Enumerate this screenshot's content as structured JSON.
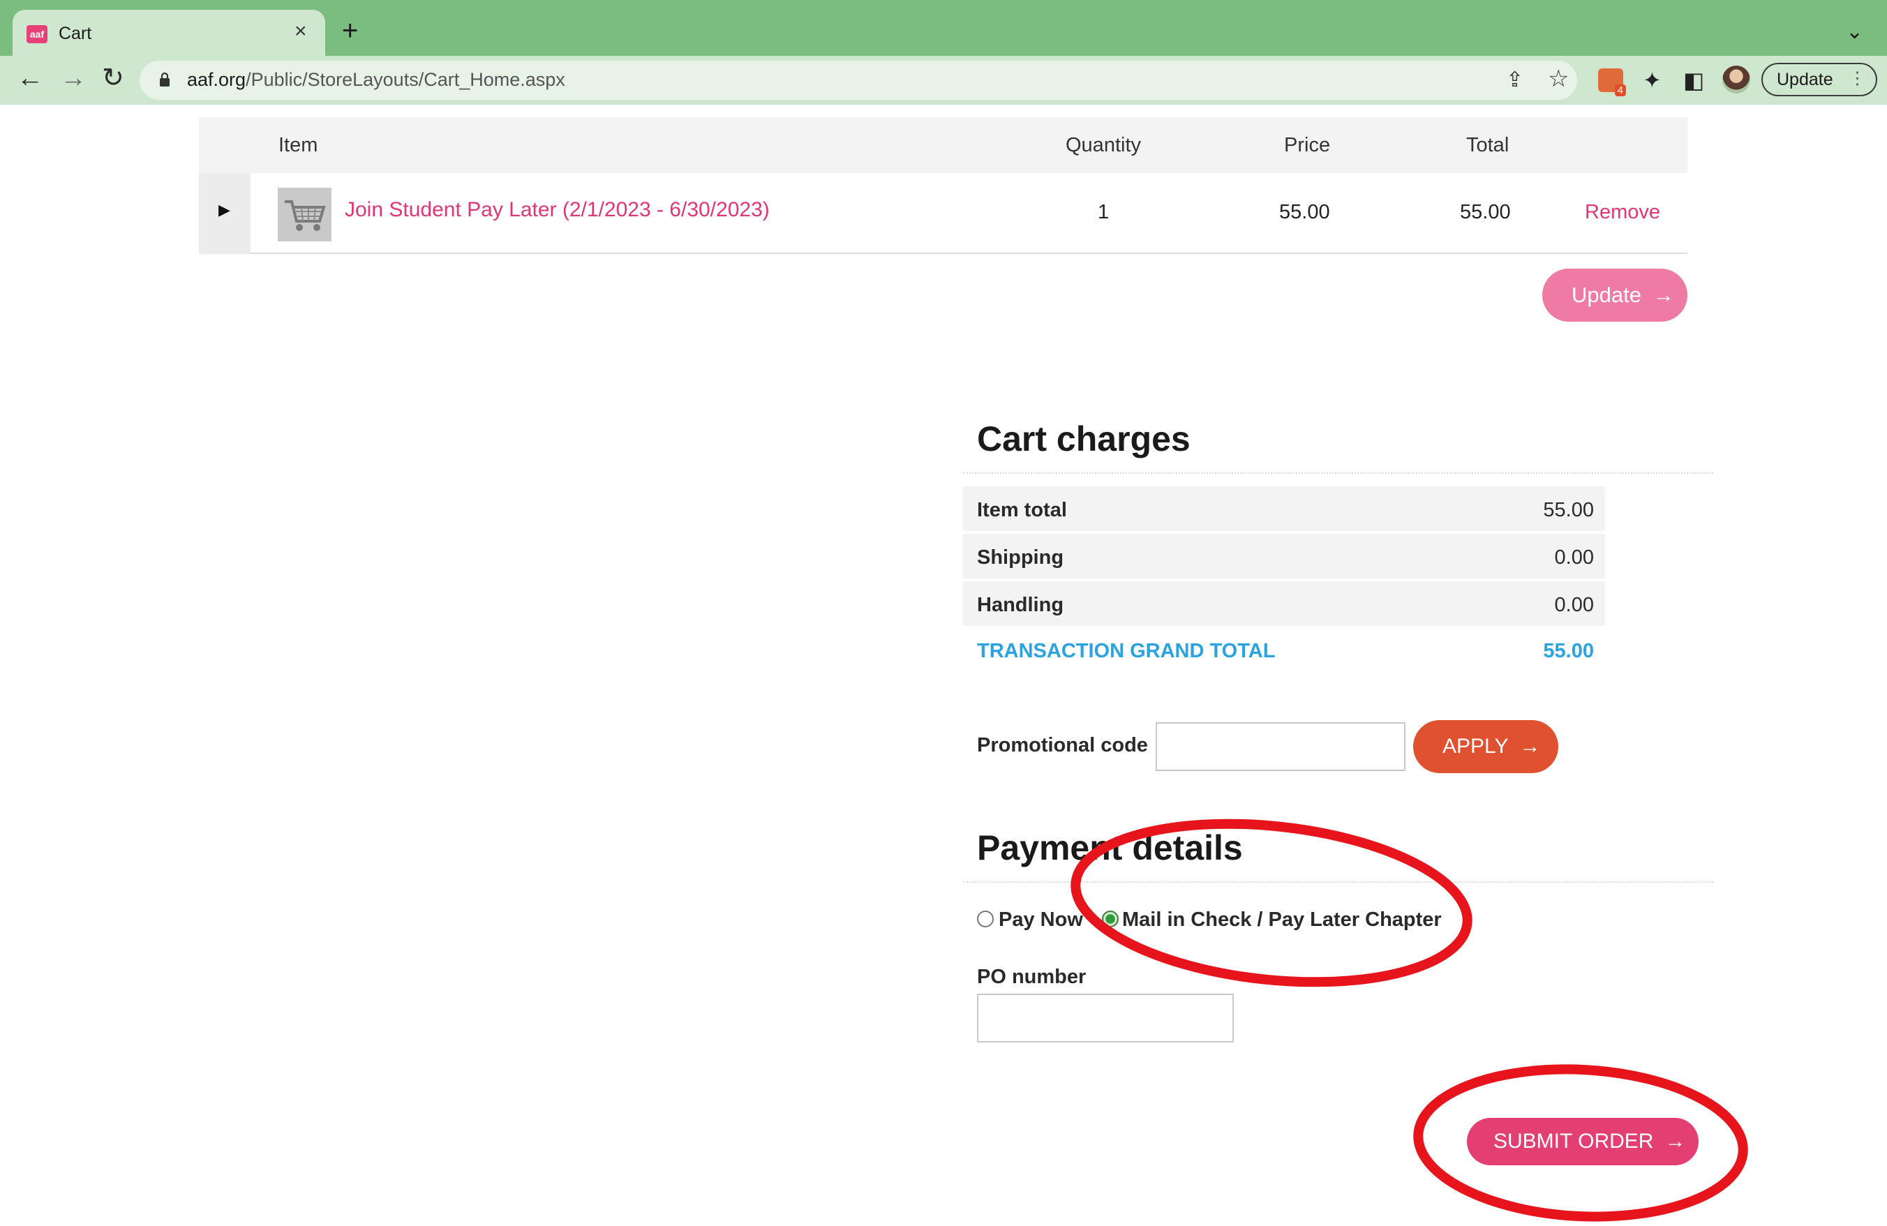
{
  "browser": {
    "tab_title": "Cart",
    "favicon_text": "aaf",
    "tab_close": "×",
    "new_tab": "+",
    "tab_menu": "⌄",
    "url_domain": "aaf.org",
    "url_path": "/Public/StoreLayouts/Cart_Home.aspx",
    "extension_badge": "4",
    "update_label": "Update",
    "update_menu": "⋮",
    "icons": {
      "back": "←",
      "forward": "→",
      "reload": "↻",
      "share": "⇪",
      "star": "☆",
      "puzzle": "✦",
      "sidebar": "◧"
    }
  },
  "cart": {
    "headers": {
      "item": "Item",
      "quantity": "Quantity",
      "price": "Price",
      "total": "Total"
    },
    "row": {
      "expand_icon": "▶",
      "name": "Join Student Pay Later (2/1/2023 - 6/30/2023)",
      "quantity": "1",
      "price": "55.00",
      "total": "55.00",
      "remove": "Remove"
    },
    "update_button": "Update",
    "arrow": "→"
  },
  "charges": {
    "title": "Cart charges",
    "rows": [
      {
        "label": "Item total",
        "value": "55.00"
      },
      {
        "label": "Shipping",
        "value": "0.00"
      },
      {
        "label": "Handling",
        "value": "0.00"
      }
    ],
    "grand_total": {
      "label": "TRANSACTION GRAND TOTAL",
      "value": "55.00"
    }
  },
  "promo": {
    "label": "Promotional code",
    "value": "",
    "apply_button": "APPLY"
  },
  "payment": {
    "title": "Payment details",
    "options": [
      {
        "label": "Pay Now",
        "selected": false
      },
      {
        "label": "Mail in Check / Pay Later Chapter",
        "selected": true
      }
    ],
    "po_label": "PO number",
    "po_value": "",
    "submit_button": "SUBMIT ORDER"
  },
  "colors": {
    "chrome_green": "#7bbd7f",
    "link_pink": "#e03673",
    "update_pink": "#ef7aa3",
    "apply_orange": "#e0522f",
    "submit_pink": "#e43f73",
    "grand_total_blue": "#2aa3e0",
    "annotation_red": "#e8141c"
  }
}
